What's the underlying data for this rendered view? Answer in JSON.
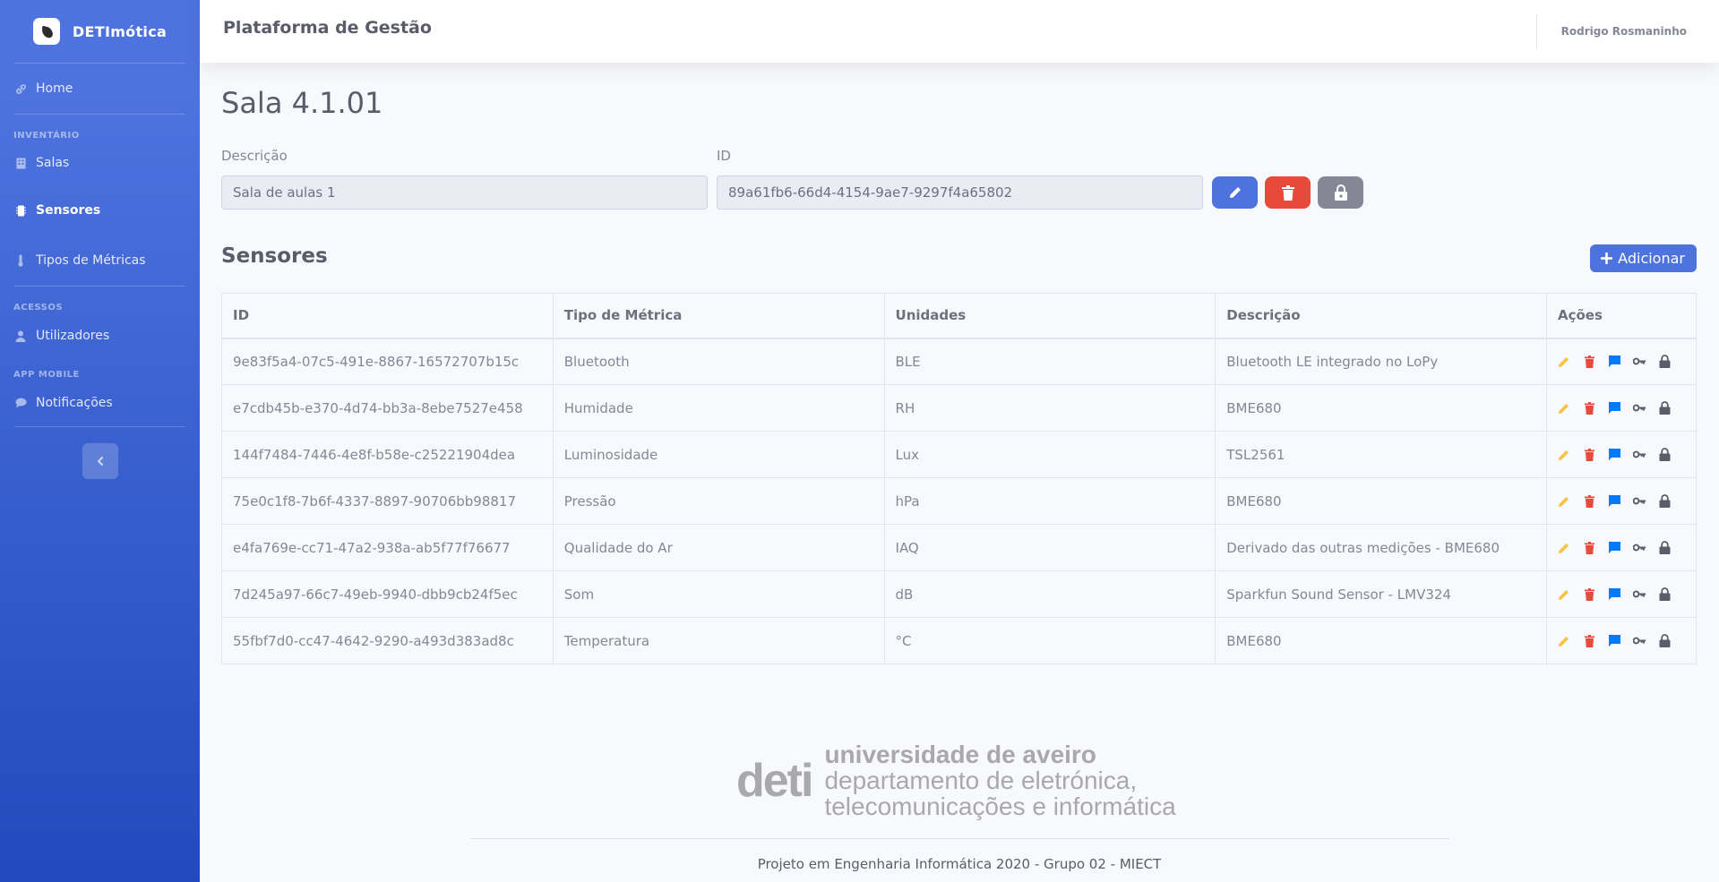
{
  "brand": {
    "name": "DETImótica"
  },
  "sidebar": {
    "home": "Home",
    "section_inventory": "INVENTÁRIO",
    "salas": "Salas",
    "sensores": "Sensores",
    "tipos_metricas": "Tipos de Métricas",
    "section_access": "ACESSOS",
    "utilizadores": "Utilizadores",
    "section_app": "APP MOBILE",
    "notificacoes": "Notificações"
  },
  "topbar": {
    "title": "Plataforma de Gestão",
    "user": "Rodrigo Rosmaninho"
  },
  "page": {
    "title": "Sala 4.1.01"
  },
  "form": {
    "desc_label": "Descrição",
    "desc_value": "Sala de aulas 1",
    "id_label": "ID",
    "id_value": "89a61fb6-66d4-4154-9ae7-9297f4a65802"
  },
  "sensors": {
    "title": "Sensores",
    "add_label": "Adicionar",
    "columns": [
      "ID",
      "Tipo de Métrica",
      "Unidades",
      "Descrição",
      "Ações"
    ],
    "rows": [
      [
        "9e83f5a4-07c5-491e-8867-16572707b15c",
        "Bluetooth",
        "BLE",
        "Bluetooth LE integrado no LoPy"
      ],
      [
        "e7cdb45b-e370-4d74-bb3a-8ebe7527e458",
        "Humidade",
        "RH",
        "BME680"
      ],
      [
        "144f7484-7446-4e8f-b58e-c25221904dea",
        "Luminosidade",
        "Lux",
        "TSL2561"
      ],
      [
        "75e0c1f8-7b6f-4337-8897-90706bb98817",
        "Pressão",
        "hPa",
        "BME680"
      ],
      [
        "e4fa769e-cc71-47a2-938a-ab5f77f76677",
        "Qualidade do Ar",
        "IAQ",
        "Derivado das outras medições - BME680"
      ],
      [
        "7d245a97-66c7-49eb-9940-dbb9cb24f5ec",
        "Som",
        "dB",
        "Sparkfun Sound Sensor - LMV324"
      ],
      [
        "55fbf7d0-cc47-4642-9290-a493d383ad8c",
        "Temperatura",
        "°C",
        "BME680"
      ]
    ]
  },
  "footer": {
    "logo_deti": "deti",
    "logo_line1": "universidade de aveiro",
    "logo_line2": "departamento de eletrónica,",
    "logo_line3": "telecomunicações e informática",
    "text": "Projeto em Engenharia Informática 2020 - Grupo 02 - MIECT"
  },
  "colors": {
    "primary": "#4e73df",
    "danger": "#e74a3b",
    "secondary": "#858796",
    "warning": "#f6c23e",
    "info": "#007bff"
  },
  "icons": {
    "edit": "pencil-icon",
    "delete": "trash-icon",
    "message": "message-icon",
    "key": "key-icon",
    "lock": "lock-icon"
  }
}
